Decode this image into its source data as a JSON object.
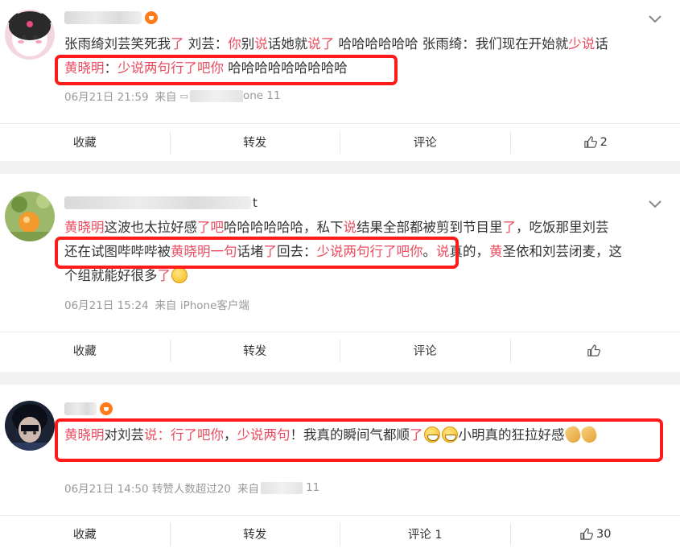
{
  "posts": [
    {
      "name_tail": "",
      "text_lines": [
        [
          {
            "t": "张雨绮刘芸笑死我",
            "hl": false
          },
          {
            "t": "了",
            "hl": true
          },
          {
            "t": " 刘芸：",
            "hl": false
          },
          {
            "t": "你",
            "hl": true
          },
          {
            "t": "别",
            "hl": false
          },
          {
            "t": "说",
            "hl": true
          },
          {
            "t": "话她就",
            "hl": false
          },
          {
            "t": "说了",
            "hl": true
          },
          {
            "t": " 哈哈哈哈哈哈 张雨绮：我们现在开始就",
            "hl": false
          },
          {
            "t": "少说",
            "hl": true
          },
          {
            "t": "话",
            "hl": false
          }
        ],
        [
          {
            "t": "黄晓明",
            "hl": true
          },
          {
            "t": "：",
            "hl": false
          },
          {
            "t": "少说两句行了吧你",
            "hl": true
          },
          {
            "t": " 哈哈哈哈哈哈哈哈哈",
            "hl": false
          }
        ]
      ],
      "date": "06月21日 21:59",
      "source_prefix": "来自",
      "source_suffix": "one 11",
      "actions": {
        "favorite": "收藏",
        "forward": "转发",
        "comment": "评论",
        "like_count": "2"
      }
    },
    {
      "name_tail": "t",
      "text_lines": [
        [
          {
            "t": "黄晓明",
            "hl": true
          },
          {
            "t": "这波也太拉好感",
            "hl": false
          },
          {
            "t": "了吧",
            "hl": true
          },
          {
            "t": "哈哈哈哈哈哈，私下",
            "hl": false
          },
          {
            "t": "说",
            "hl": true
          },
          {
            "t": "结果全部都被剪到节目里",
            "hl": false
          },
          {
            "t": "了",
            "hl": true
          },
          {
            "t": "，吃饭那里刘芸",
            "hl": false
          }
        ],
        [
          {
            "t": "还在试图哔哔哔被",
            "hl": false
          },
          {
            "t": "黄晓明一句",
            "hl": true
          },
          {
            "t": "话堵",
            "hl": false
          },
          {
            "t": "了",
            "hl": true
          },
          {
            "t": "回去：",
            "hl": false
          },
          {
            "t": "少说两句行了吧你",
            "hl": true
          },
          {
            "t": "。",
            "hl": false
          },
          {
            "t": "说",
            "hl": true
          },
          {
            "t": "真的，",
            "hl": false
          },
          {
            "t": "黄",
            "hl": true
          },
          {
            "t": "圣依和刘芸闭麦，这",
            "hl": false
          }
        ],
        [
          {
            "t": "个组就能好很多",
            "hl": false
          },
          {
            "t": "了",
            "hl": true
          },
          {
            "emoji": "smile"
          }
        ]
      ],
      "date": "06月21日 15:24",
      "source_prefix": "来自 iPhone客户端",
      "source_suffix": "",
      "actions": {
        "favorite": "收藏",
        "forward": "转发",
        "comment": "评论",
        "like_count": ""
      }
    },
    {
      "name_tail": "",
      "text_lines": [
        [
          {
            "t": "黄晓明",
            "hl": true
          },
          {
            "t": "对刘芸",
            "hl": false
          },
          {
            "t": "说：行了吧你",
            "hl": true
          },
          {
            "t": "，",
            "hl": false
          },
          {
            "t": "少说两句",
            "hl": true
          },
          {
            "t": "！我真的瞬间气都顺",
            "hl": false
          },
          {
            "t": "了",
            "hl": true
          },
          {
            "emoji": "grin"
          },
          {
            "emoji": "grin"
          },
          {
            "t": "小明真的狂拉好感",
            "hl": false
          },
          {
            "emoji": "pray"
          },
          {
            "emoji": "pray"
          }
        ]
      ],
      "date": "06月21日 14:50 转赞人数超过20",
      "source_prefix": "来自",
      "source_suffix": "11",
      "actions": {
        "favorite": "收藏",
        "forward": "转发",
        "comment": "评论 1",
        "like_count": "30"
      }
    }
  ],
  "colors": {
    "highlight": "#eb4b5f",
    "redbox": "#ff1a1a",
    "meta": "#999999"
  },
  "icons": [
    "chevron-down-icon",
    "thumb-up-icon",
    "vip-badge-icon"
  ]
}
